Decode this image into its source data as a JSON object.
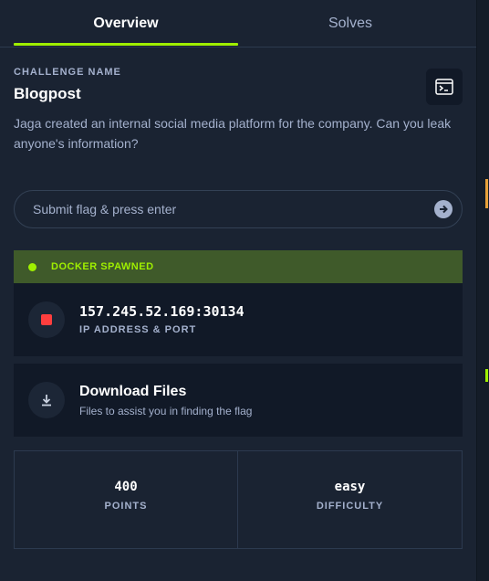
{
  "tabs": [
    {
      "label": "Overview",
      "active": true
    },
    {
      "label": "Solves",
      "active": false
    }
  ],
  "challenge": {
    "section_label": "CHALLENGE NAME",
    "name": "Blogpost",
    "description": "Jaga created an internal social media platform for the company. Can you leak anyone's information?"
  },
  "flag_input": {
    "placeholder": "Submit flag & press enter",
    "value": ""
  },
  "docker": {
    "status": "DOCKER SPAWNED",
    "ip_port": "157.245.52.169:30134",
    "ip_label": "IP ADDRESS & PORT"
  },
  "download": {
    "title": "Download Files",
    "subtitle": "Files to assist you in finding the flag"
  },
  "stats": {
    "points_value": "400",
    "points_label": "POINTS",
    "difficulty_value": "easy",
    "difficulty_label": "DIFFICULTY"
  },
  "colors": {
    "background": "#1a2332",
    "card": "#111927",
    "accent": "#9fef00",
    "muted_text": "#a4b1cd",
    "stop_red": "#ff3e3e",
    "docker_banner": "#3f5a2a"
  },
  "icons": {
    "terminal": "terminal-icon",
    "submit": "arrow-right-circle-icon",
    "status": "status-dot-icon",
    "stop": "stop-icon",
    "download": "download-icon"
  }
}
